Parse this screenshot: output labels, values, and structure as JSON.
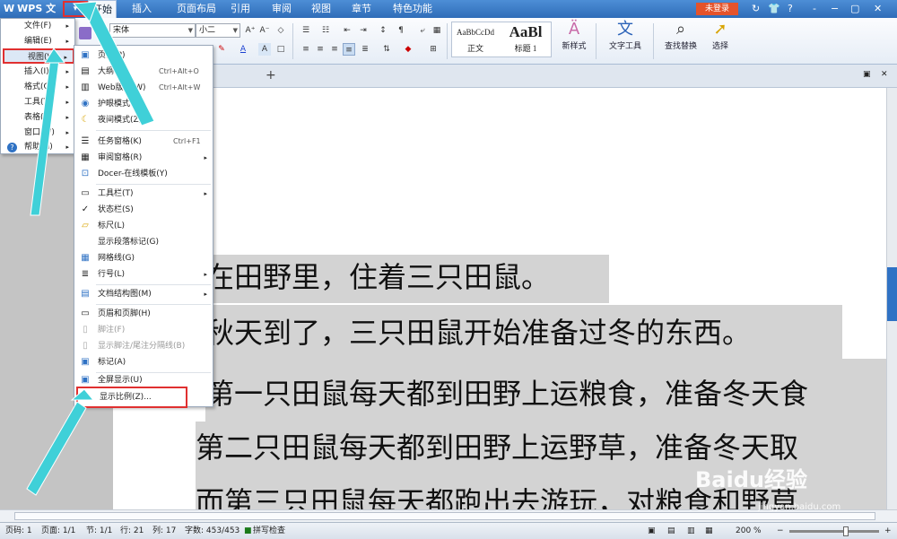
{
  "app": {
    "name": "WPS 文字",
    "dropdown": "▾"
  },
  "tabs": [
    "开始",
    "插入",
    "页面布局",
    "引用",
    "审阅",
    "视图",
    "章节",
    "特色功能"
  ],
  "login": "未登录",
  "titlebar_icons": [
    "↻",
    "👕",
    "?",
    "-",
    "−",
    "▢",
    "✕"
  ],
  "ribbon": {
    "font_name": "宋体",
    "font_size": "小二",
    "style_normal_sample": "AaBbCcDd",
    "style_normal_label": "正文",
    "style_h1_sample": "AaBl",
    "style_h1_label": "标题 1",
    "new_style": "新样式",
    "text_tools": "文字工具",
    "find_replace": "查找替换",
    "select": "选择"
  },
  "menu1": [
    {
      "label": "文件(F)",
      "arrow": "▸"
    },
    {
      "label": "编辑(E)",
      "arrow": "▸"
    },
    {
      "label": "视图(V)",
      "arrow": "▸"
    },
    {
      "label": "插入(I)",
      "arrow": "▸"
    },
    {
      "label": "格式(O)",
      "arrow": "▸"
    },
    {
      "label": "工具(T)",
      "arrow": "▸"
    },
    {
      "label": "表格(A)",
      "arrow": "▸"
    },
    {
      "label": "窗口(W)",
      "arrow": "▸"
    },
    {
      "label": "帮助(H)",
      "arrow": "▸"
    }
  ],
  "menu2": [
    {
      "label": "页面(P)",
      "shortcut": "",
      "arrow": ""
    },
    {
      "label": "大纲(O)",
      "shortcut": "Ctrl+Alt+O",
      "arrow": ""
    },
    {
      "label": "Web版式(W)",
      "shortcut": "Ctrl+Alt+W",
      "arrow": ""
    },
    {
      "label": "护眼模式(E)",
      "shortcut": "",
      "arrow": ""
    },
    {
      "label": "夜间模式(Z)",
      "shortcut": "",
      "arrow": ""
    },
    {
      "label": "任务窗格(K)",
      "shortcut": "Ctrl+F1",
      "arrow": ""
    },
    {
      "label": "审阅窗格(R)",
      "shortcut": "",
      "arrow": "▸"
    },
    {
      "label": "Docer-在线模板(Y)",
      "shortcut": "",
      "arrow": ""
    },
    {
      "label": "工具栏(T)",
      "shortcut": "",
      "arrow": "▸"
    },
    {
      "label": "状态栏(S)",
      "shortcut": "",
      "arrow": ""
    },
    {
      "label": "标尺(L)",
      "shortcut": "",
      "arrow": ""
    },
    {
      "label": "显示段落标记(G)",
      "shortcut": "",
      "arrow": ""
    },
    {
      "label": "网格线(G)",
      "shortcut": "",
      "arrow": ""
    },
    {
      "label": "行号(L)",
      "shortcut": "",
      "arrow": "▸"
    },
    {
      "label": "文档结构图(M)",
      "shortcut": "",
      "arrow": "▸"
    },
    {
      "label": "页眉和页脚(H)",
      "shortcut": "",
      "arrow": ""
    },
    {
      "label": "脚注(F)",
      "shortcut": "",
      "arrow": ""
    },
    {
      "label": "显示脚注/尾注分隔线(B)",
      "shortcut": "",
      "arrow": ""
    },
    {
      "label": "标记(A)",
      "shortcut": "",
      "arrow": ""
    },
    {
      "label": "全屏显示(U)",
      "shortcut": "",
      "arrow": ""
    },
    {
      "label": "显示比例(Z)...",
      "shortcut": "",
      "arrow": ""
    }
  ],
  "document": {
    "lines": [
      "在田野里，住着三只田鼠。",
      "秋天到了，三只田鼠开始准备过冬的东西。",
      "第一只田鼠每天都到田野上运粮食，准备冬天食",
      "第二只田鼠每天都到田野上运野草，准备冬天取",
      "而第三只田鼠每天都跑出去游玩，对粮食和野草"
    ]
  },
  "status": {
    "page_code": "页码: 1",
    "pages": "页面: 1/1",
    "section": "节: 1/1",
    "row": "行: 21",
    "col": "列: 17",
    "chars": "字数: 453/453",
    "spell": "拼写检查",
    "zoom": "200 %"
  },
  "watermark": {
    "brand": "Baidu经验",
    "url": "jingyan.baidu.com"
  }
}
